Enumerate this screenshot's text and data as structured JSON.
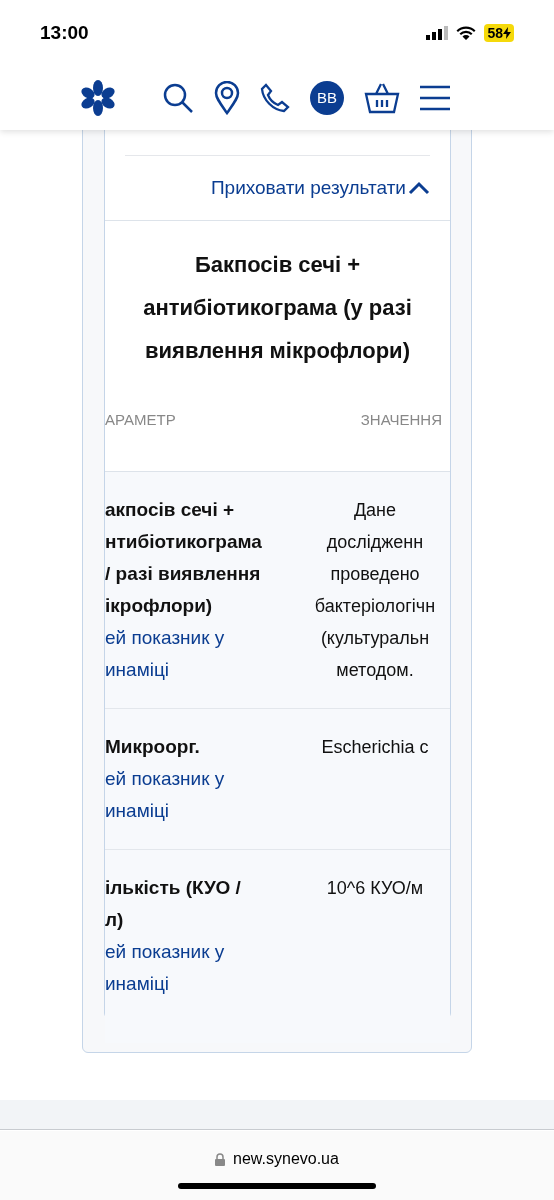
{
  "status_bar": {
    "time": "13:00",
    "battery": "58"
  },
  "header": {
    "avatar": "BB"
  },
  "card": {
    "hide_link": "Приховати результати",
    "title": "Бакпосів сечі + антибіотикограма (у разі виявлення мікрофлори)",
    "columns": [
      "АРАМЕТР",
      "ЗНАЧЕННЯ"
    ],
    "rows": [
      {
        "parameter": [
          "акпосів сечі +",
          "нтибіотикограма",
          "/ разі виявлення",
          "ікрофлори)"
        ],
        "link": [
          "ей показник у",
          "инаміці"
        ],
        "value": [
          "Дане",
          "дослідженн",
          "проведено",
          "бактеріологічн",
          "(культуральн",
          "методом."
        ]
      },
      {
        "parameter": [
          "Микроорг."
        ],
        "link": [
          "ей показник у",
          "инаміці"
        ],
        "value": [
          "Escherichia c"
        ]
      },
      {
        "parameter": [
          "ількість (КУО /",
          "л)"
        ],
        "link": [
          "ей показник у",
          "инаміці"
        ],
        "value": [
          "10^6 КУО/м"
        ]
      }
    ]
  },
  "browser": {
    "url": "new.synevo.ua"
  }
}
